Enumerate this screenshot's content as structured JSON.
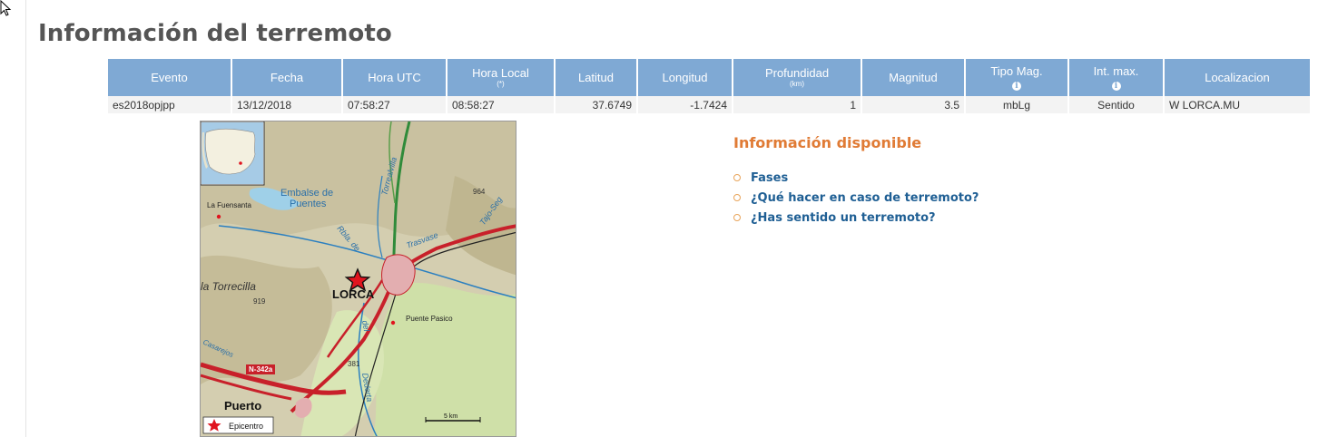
{
  "page": {
    "title": "Información del terremoto"
  },
  "table": {
    "headers": [
      {
        "label": "Evento"
      },
      {
        "label": "Fecha"
      },
      {
        "label": "Hora UTC"
      },
      {
        "label": "Hora Local",
        "note": "(*)"
      },
      {
        "label": "Latitud"
      },
      {
        "label": "Longitud"
      },
      {
        "label": "Profundidad",
        "note": "(km)"
      },
      {
        "label": "Magnitud"
      },
      {
        "label": "Tipo Mag.",
        "icon": "info-icon"
      },
      {
        "label": "Int. max.",
        "icon": "info-icon"
      },
      {
        "label": "Localizacion"
      }
    ],
    "row": [
      "es2018opjpp",
      "13/12/2018",
      "07:58:27",
      "08:58:27",
      "37.6749",
      "-1.7424",
      "1",
      "3.5",
      "mbLg",
      "Sentido",
      "W LORCA.MU"
    ]
  },
  "map": {
    "labels": {
      "embalse": "Embalse de",
      "puentes": "Puentes",
      "fuensanta": "La Fuensanta",
      "torrecilla": "la Torrecilla",
      "alt919": "919",
      "alt964": "964",
      "alt381": "381",
      "lorca": "LORCA",
      "puente_pasico": "Puente Pasico",
      "puerto": "Puerto",
      "road": "N-342a",
      "scale": "5 km",
      "rambla": "Rbla. de",
      "torrealvilla": "Torrealvilla",
      "trasvase": "Trasvase",
      "tajo": "Tajo-Seg",
      "casarejos": "Casarejos",
      "dederta": "Dederta",
      "del": "del",
      "legend": "Epicentro"
    },
    "colors": {
      "epicenter": "#e0141e",
      "road": "#c8202a",
      "river": "#2a7fc0",
      "relief": "#d9d2a6"
    }
  },
  "available": {
    "title": "Información disponible",
    "links": [
      "Fases",
      "¿Qué hacer en caso de terremoto?",
      "¿Has sentido un terremoto?"
    ]
  }
}
